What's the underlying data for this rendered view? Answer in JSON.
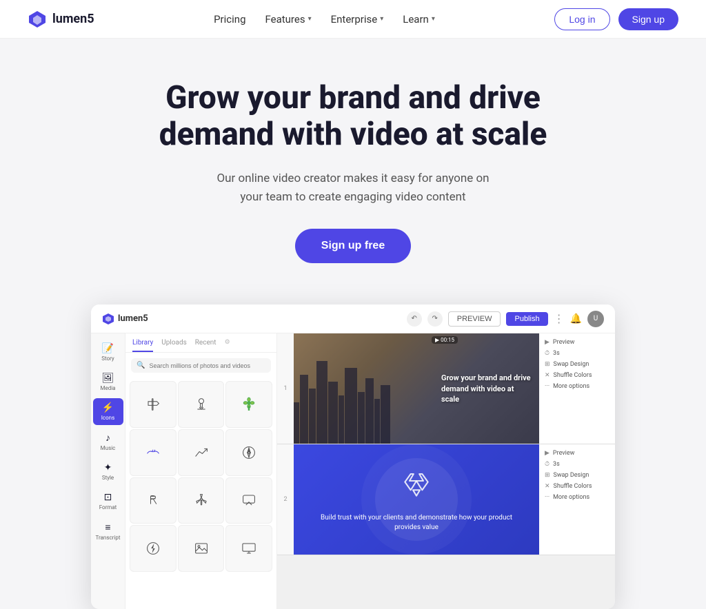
{
  "brand": {
    "name": "lumen5",
    "logo_color": "#4F46E5"
  },
  "nav": {
    "links": [
      {
        "label": "Pricing",
        "has_dropdown": false
      },
      {
        "label": "Features",
        "has_dropdown": true
      },
      {
        "label": "Enterprise",
        "has_dropdown": true
      },
      {
        "label": "Learn",
        "has_dropdown": true
      }
    ],
    "login_label": "Log in",
    "signup_label": "Sign up"
  },
  "hero": {
    "heading_line1": "Grow your brand and drive",
    "heading_line2": "demand with video at scale",
    "subtext": "Our online video creator makes it easy for anyone on your team to create engaging video content",
    "cta_label": "Sign up free"
  },
  "mockup": {
    "logo": "lumen5",
    "btn_preview": "PREVIEW",
    "btn_publish": "Publish",
    "panel_tabs": [
      "Library",
      "Uploads",
      "Recent"
    ],
    "search_placeholder": "Search millions of photos and videos",
    "sidebar_items": [
      {
        "icon": "📝",
        "label": "Story"
      },
      {
        "icon": "🖼",
        "label": "Media"
      },
      {
        "icon": "⚡",
        "label": "Icons",
        "active": true
      },
      {
        "icon": "♪",
        "label": "Music"
      },
      {
        "icon": "✦",
        "label": "Style"
      },
      {
        "icon": "⊡",
        "label": "Format"
      },
      {
        "icon": "≡",
        "label": "Transcript"
      }
    ],
    "slide1": {
      "number": "1",
      "timer": "00:15",
      "overlay_text": "Grow your brand and drive demand with video at scale",
      "options": [
        {
          "icon": "▶",
          "label": "Preview"
        },
        {
          "icon": "⏱",
          "label": "3s"
        },
        {
          "icon": "⊞",
          "label": "Swap Design"
        },
        {
          "icon": "✕",
          "label": "Shuffle Colors"
        },
        {
          "icon": "···",
          "label": "More options"
        }
      ]
    },
    "slide2": {
      "number": "2",
      "overlay_text": "Build trust with your clients and demonstrate how your product provides value",
      "options": [
        {
          "icon": "▶",
          "label": "Preview"
        },
        {
          "icon": "⏱",
          "label": "3s"
        },
        {
          "icon": "⊞",
          "label": "Swap Design"
        },
        {
          "icon": "✕",
          "label": "Shuffle Colors"
        },
        {
          "icon": "···",
          "label": "More options"
        }
      ]
    }
  }
}
